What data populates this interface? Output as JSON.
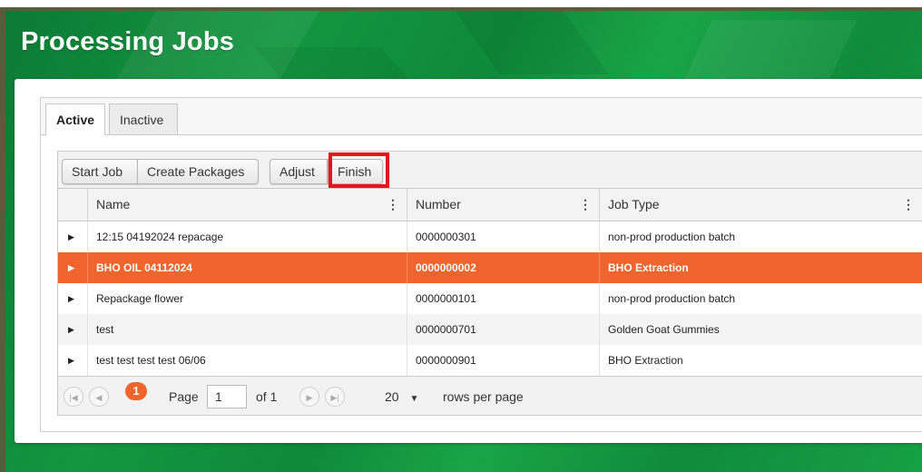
{
  "page": {
    "title": "Processing Jobs"
  },
  "tabs": [
    {
      "label": "Active"
    },
    {
      "label": "Inactive"
    }
  ],
  "toolbar": {
    "start_job": "Start Job",
    "create_packages": "Create Packages",
    "adjust": "Adjust",
    "finish": "Finish"
  },
  "columns": [
    {
      "label": "Name"
    },
    {
      "label": "Number"
    },
    {
      "label": "Job Type"
    }
  ],
  "rows": [
    {
      "name": "12:15 04192024 repacage",
      "number": "0000000301",
      "job_type": "non-prod production batch"
    },
    {
      "name": "BHO OIL 04112024",
      "number": "0000000002",
      "job_type": "BHO Extraction"
    },
    {
      "name": "Repackage flower",
      "number": "0000000101",
      "job_type": "non-prod production batch"
    },
    {
      "name": "test",
      "number": "0000000701",
      "job_type": "Golden Goat Gummies"
    },
    {
      "name": "test test test test 06/06",
      "number": "0000000901",
      "job_type": "BHO Extraction"
    }
  ],
  "pager": {
    "current_page": "1",
    "page_label": "Page",
    "page_value": "1",
    "of_label": "of 1",
    "page_size": "20",
    "rows_label": "rows per page"
  },
  "icons": {
    "expand": "expand-arrow-icon",
    "menu": "column-menu-icon",
    "first": "first-page-icon",
    "prev": "prev-page-icon",
    "next": "next-page-icon",
    "last": "last-page-icon"
  },
  "colors": {
    "selected_row": "#f0652e",
    "highlight_box": "#e8141b",
    "banner": "#13963f"
  }
}
